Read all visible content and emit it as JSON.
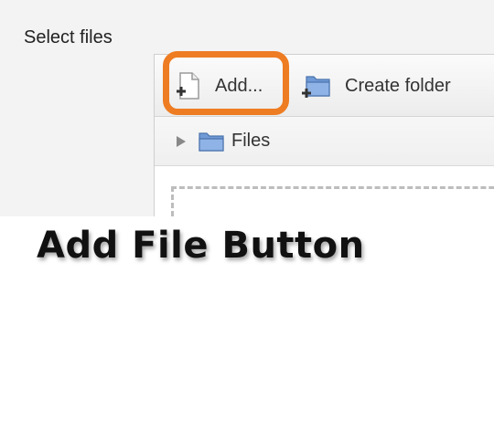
{
  "section": {
    "label": "Select files"
  },
  "toolbar": {
    "add_label": "Add...",
    "create_folder_label": "Create folder"
  },
  "path": {
    "root_label": "Files"
  },
  "caption": {
    "text": "Add File Button"
  },
  "colors": {
    "highlight": "#ee7c22",
    "folder": "#6f9ad6",
    "background": "#f3f3f3"
  },
  "icons": {
    "add": "file-add-icon",
    "create_folder": "folder-add-icon",
    "expand": "triangle-right-icon",
    "folder": "folder-icon"
  }
}
